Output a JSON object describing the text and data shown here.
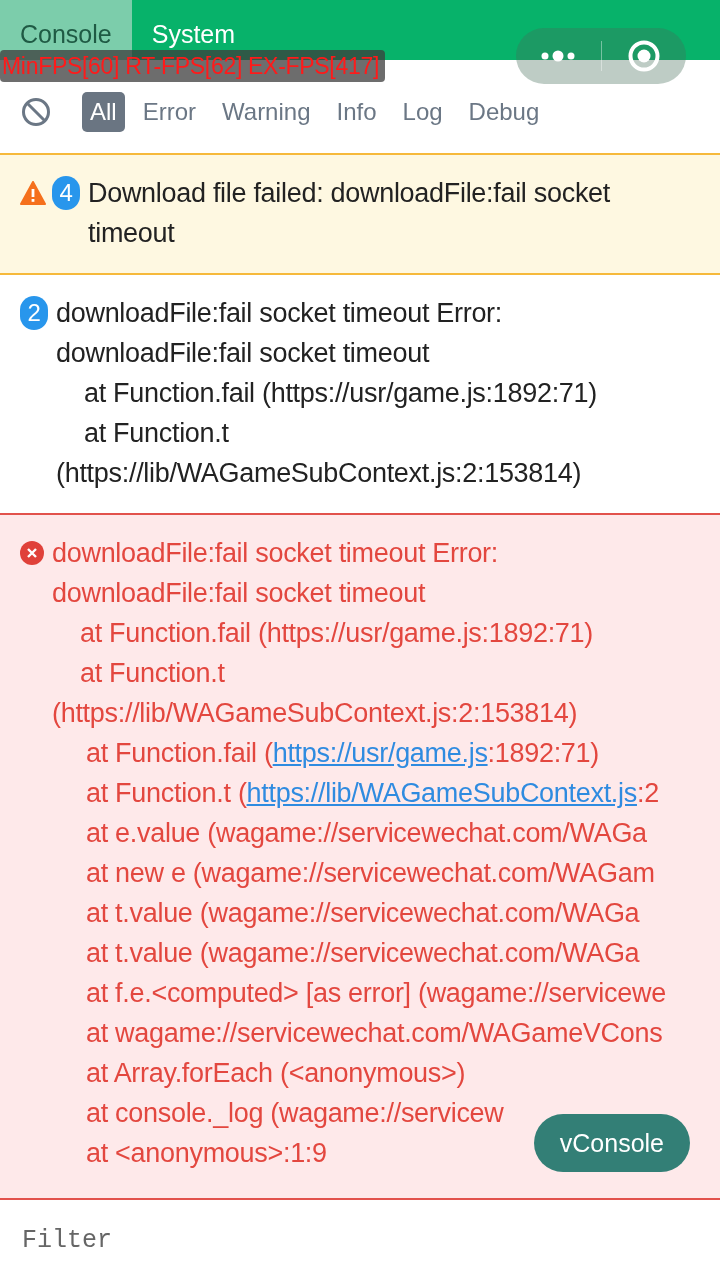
{
  "tabs": [
    {
      "label": "Console",
      "selected": true
    },
    {
      "label": "System",
      "selected": false
    }
  ],
  "fps_overlay": "MinFPS[60] RT-FPS[62] EX-FPS[417]",
  "filters": [
    {
      "label": "All",
      "selected": true
    },
    {
      "label": "Error",
      "selected": false
    },
    {
      "label": "Warning",
      "selected": false
    },
    {
      "label": "Info",
      "selected": false
    },
    {
      "label": "Log",
      "selected": false
    },
    {
      "label": "Debug",
      "selected": false
    }
  ],
  "logs": [
    {
      "kind": "warn",
      "count": "4",
      "lines": [
        {
          "kind": "message",
          "text": "Download file failed: downloadFile:fail socket"
        },
        {
          "kind": "message",
          "text": "timeout"
        }
      ]
    },
    {
      "kind": "log",
      "count": "2",
      "lines": [
        {
          "kind": "message",
          "text": "downloadFile:fail socket timeout Error:"
        },
        {
          "kind": "message",
          "text": "downloadFile:fail socket timeout"
        },
        {
          "kind": "frame",
          "text": "at Function.fail (https://usr/game.js:1892:71)"
        },
        {
          "kind": "frame",
          "text": "at Function.t"
        },
        {
          "kind": "message",
          "text": "(https://lib/WAGameSubContext.js:2:153814)"
        }
      ]
    },
    {
      "kind": "error",
      "lines": [
        {
          "kind": "message",
          "text": "downloadFile:fail socket timeout Error:"
        },
        {
          "kind": "message",
          "text": "downloadFile:fail socket timeout"
        },
        {
          "kind": "frame",
          "text": "at Function.fail (https://usr/game.js:1892:71)"
        },
        {
          "kind": "frame",
          "text": "at Function.t"
        },
        {
          "kind": "message",
          "text": "(https://lib/WAGameSubContext.js:2:153814)"
        },
        {
          "kind": "deep_frame",
          "parts": [
            {
              "kind": "text",
              "text": "at Function.fail ("
            },
            {
              "kind": "link",
              "text": "https://usr/game.js"
            },
            {
              "kind": "text",
              "text": ":1892:71)"
            }
          ]
        },
        {
          "kind": "deep_frame",
          "parts": [
            {
              "kind": "text",
              "text": "at Function.t ("
            },
            {
              "kind": "link",
              "text": "https://lib/WAGameSubContext.js"
            },
            {
              "kind": "text",
              "text": ":2"
            }
          ]
        },
        {
          "kind": "deep_frame",
          "text": "at e.value (wagame://servicewechat.com/WAGa"
        },
        {
          "kind": "deep_frame",
          "text": "at new e (wagame://servicewechat.com/WAGam"
        },
        {
          "kind": "deep_frame",
          "text": "at t.value (wagame://servicewechat.com/WAGa"
        },
        {
          "kind": "deep_frame",
          "text": "at t.value (wagame://servicewechat.com/WAGa"
        },
        {
          "kind": "deep_frame",
          "text": "at f.e.<computed> [as error] (wagame://servicewe"
        },
        {
          "kind": "deep_frame",
          "text": "at wagame://servicewechat.com/WAGameVCons"
        },
        {
          "kind": "deep_frame",
          "text": "at Array.forEach (<anonymous>)"
        },
        {
          "kind": "deep_frame",
          "text": "at console._log (wagame://servicew"
        },
        {
          "kind": "deep_frame",
          "text": "at <anonymous>:1:9"
        }
      ]
    }
  ],
  "floating_button": "vConsole",
  "filter_field": {
    "placeholder": "Filter"
  }
}
